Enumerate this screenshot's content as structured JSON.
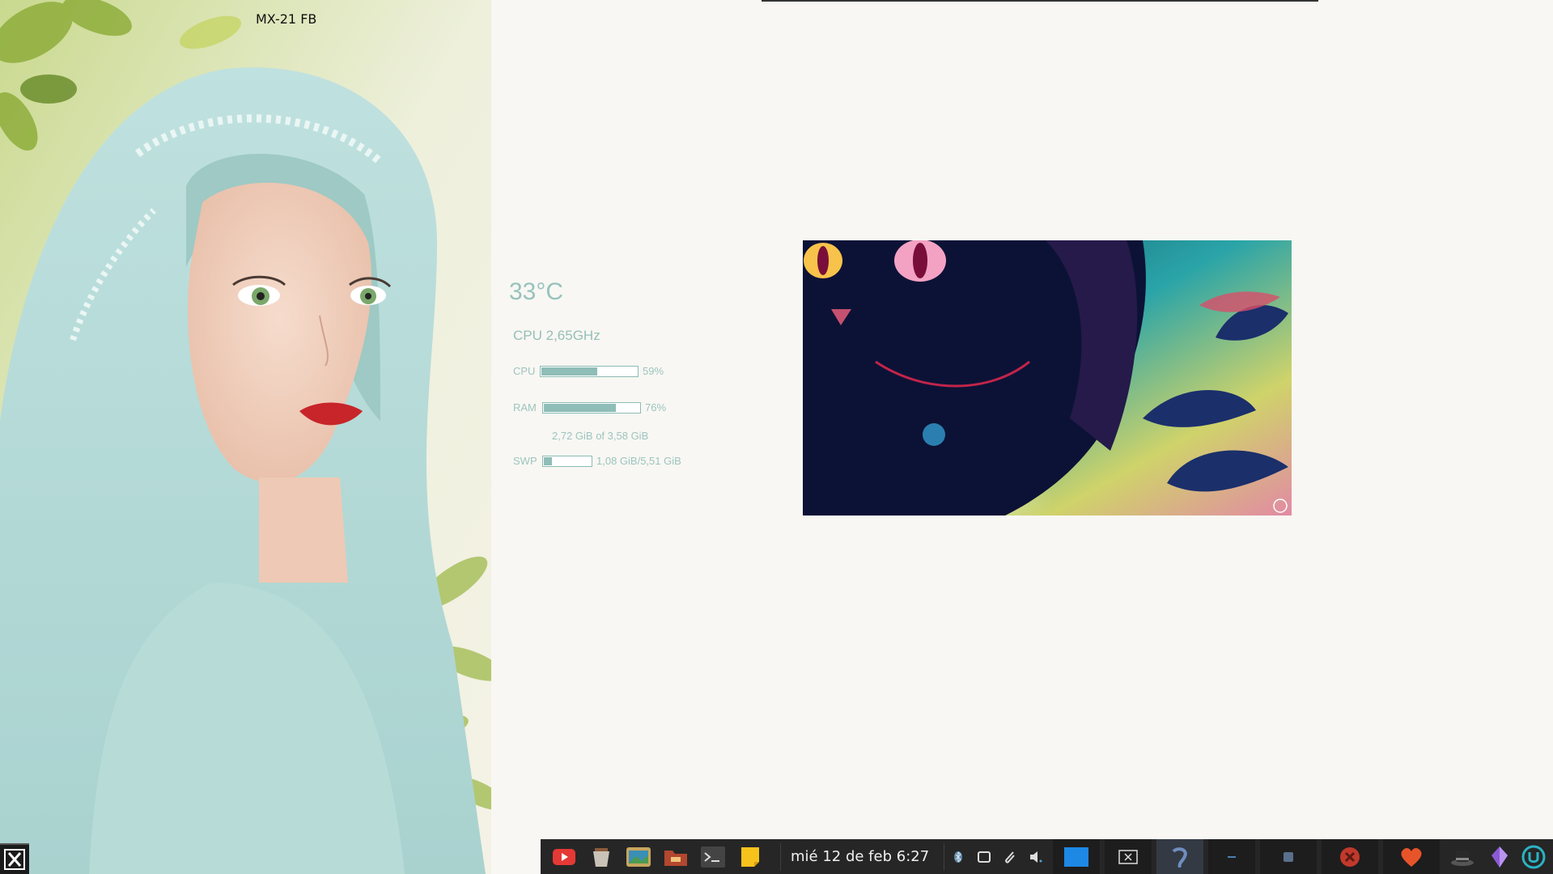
{
  "desktop": {
    "label": "MX-21 FB"
  },
  "monitor": {
    "temperature": "33°C",
    "cpu_freq": "CPU 2,65GHz",
    "cpu": {
      "label": "CPU",
      "percent_text": "59%",
      "level": 0.59
    },
    "ram": {
      "label": "RAM",
      "percent_text": "76%",
      "level": 0.76,
      "detail": "2,72 GiB of 3,58 GiB"
    },
    "swap": {
      "label": "SWP",
      "detail": "1,08 GiB/5,51 GiB",
      "level": 0.196
    }
  },
  "taskbar": {
    "clock": "mié 12 de feb  6:27",
    "launchers": [
      "youtube-icon",
      "bucket-icon",
      "photo-viewer-icon",
      "folder-icon",
      "terminal-icon",
      "sticky-note-icon"
    ],
    "tray": [
      "bluetooth-icon",
      "screen-icon",
      "clip-icon",
      "volume-icon"
    ],
    "tasks": [
      "window-task-blue",
      "window-task-close",
      "app-task-swirl",
      "app-task-minimized",
      "app-task-window",
      "app-task-red",
      "app-task-heart",
      "app-task-hat",
      "app-task-crystal",
      "power-icon"
    ]
  },
  "colors": {
    "accent": "#8fbdb7",
    "taskbar": "#262626",
    "desktop": "#f8f7f3"
  }
}
